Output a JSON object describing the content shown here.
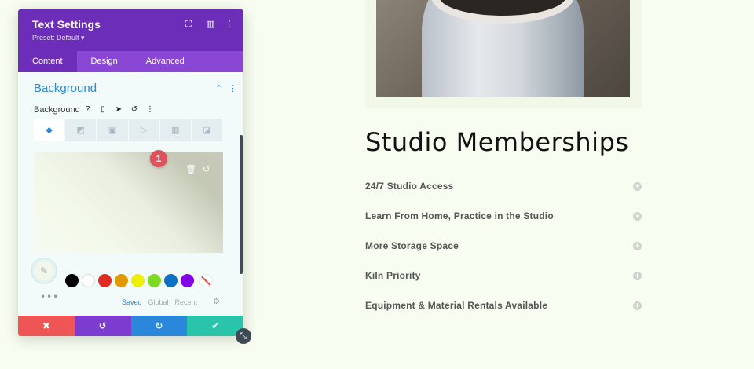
{
  "panel": {
    "title": "Text Settings",
    "preset": "Preset: Default ▾",
    "header_icons": {
      "focus": "⛶",
      "split": "▥",
      "menu": "⋮"
    },
    "tabs": [
      {
        "label": "Content",
        "active": true
      },
      {
        "label": "Design",
        "active": false
      },
      {
        "label": "Advanced",
        "active": false
      }
    ],
    "section": {
      "title": "Background",
      "collapse_icon": "⌃",
      "menu_icon": "⋮"
    },
    "background_label": "Background",
    "background_icons": {
      "help": "?",
      "device": "▯",
      "hover": "➤",
      "reset": "↺",
      "menu": "⋮"
    },
    "background_tabs": [
      {
        "name": "color-tab-icon",
        "glyph": "◆",
        "active": true
      },
      {
        "name": "gradient-tab-icon",
        "glyph": "◩",
        "active": false
      },
      {
        "name": "image-tab-icon",
        "glyph": "▣",
        "active": false
      },
      {
        "name": "video-tab-icon",
        "glyph": "▷",
        "active": false
      },
      {
        "name": "pattern-tab-icon",
        "glyph": "▦",
        "active": false
      },
      {
        "name": "mask-tab-icon",
        "glyph": "◪",
        "active": false
      }
    ],
    "preview_controls": {
      "delete": "🗑",
      "reset": "↺"
    },
    "badge": "1",
    "picker_icon": "✎",
    "swatches": [
      {
        "color": "#000000"
      },
      {
        "color": "#ffffff"
      },
      {
        "color": "#e02b20"
      },
      {
        "color": "#e09900"
      },
      {
        "color": "#edf000"
      },
      {
        "color": "#7cda24"
      },
      {
        "color": "#0c71c3"
      },
      {
        "color": "#8300e9"
      }
    ],
    "more": "•••",
    "palette_tabs": [
      {
        "label": "Saved",
        "active": true
      },
      {
        "label": "Global",
        "active": false
      },
      {
        "label": "Recent",
        "active": false
      }
    ],
    "settings_icon": "⚙",
    "footer": [
      {
        "action": "discard",
        "glyph": "✖",
        "color": "#ef5555"
      },
      {
        "action": "undo",
        "glyph": "↺",
        "color": "#7e3bd0"
      },
      {
        "action": "redo",
        "glyph": "↻",
        "color": "#2b87da"
      },
      {
        "action": "save",
        "glyph": "✔",
        "color": "#29c4a9"
      }
    ],
    "resize_icon": "⤡"
  },
  "page": {
    "heading": "Studio Memberships",
    "faq_items": [
      "24/7 Studio Access",
      "Learn From Home, Practice in the Studio",
      "More Storage Space",
      "Kiln Priority",
      "Equipment & Material Rentals Available"
    ],
    "toggle_glyph": "+"
  }
}
